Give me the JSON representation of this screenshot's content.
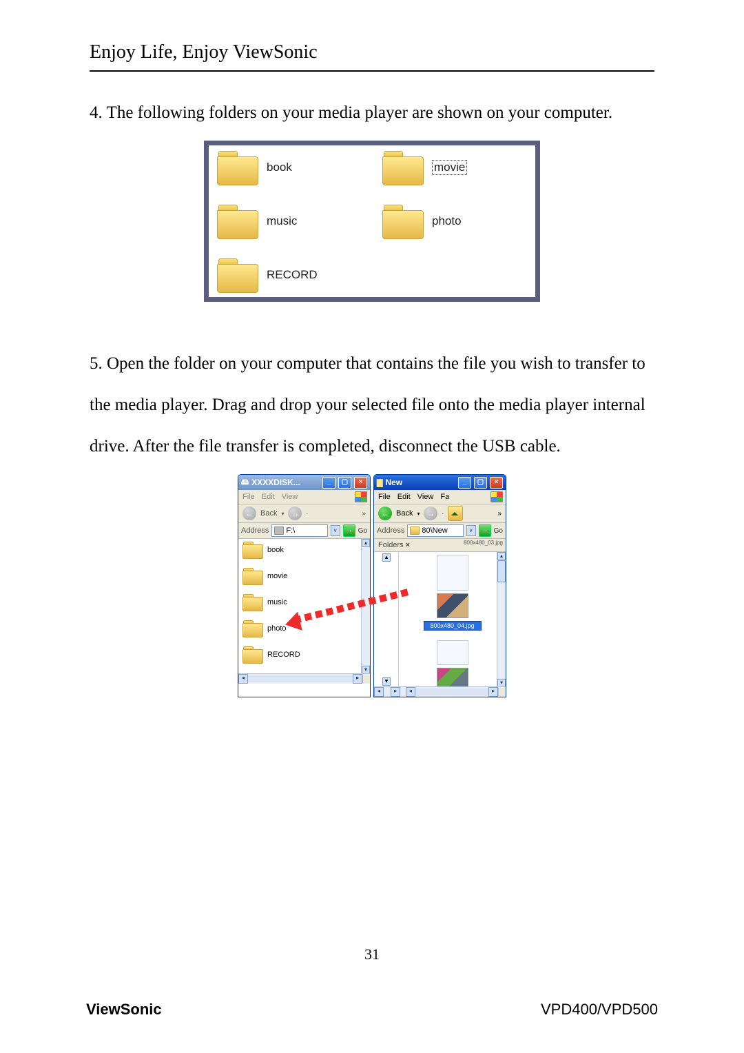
{
  "header": {
    "tagline": "Enjoy Life, Enjoy ViewSonic"
  },
  "step4": {
    "text": "4. The following folders on your media player are shown on your computer."
  },
  "folders_view": {
    "items": [
      {
        "label": "book"
      },
      {
        "label": "movie",
        "selected": true
      },
      {
        "label": "music"
      },
      {
        "label": "photo"
      },
      {
        "label": "RECORD"
      }
    ]
  },
  "step5": {
    "text": "5. Open the folder on your computer that contains the file you wish to transfer to the media player. Drag and drop your selected file onto the media player internal drive. After the file transfer is completed, disconnect the USB cable."
  },
  "explorer_left": {
    "title": "XXXXDISK...",
    "menu": {
      "file": "File",
      "edit": "Edit",
      "view": "View",
      "more": "»"
    },
    "toolbar": {
      "back": "Back",
      "more": "»"
    },
    "address": {
      "label": "Address",
      "value": "F:\\",
      "go": "Go"
    },
    "folders": [
      {
        "label": "book"
      },
      {
        "label": "movie"
      },
      {
        "label": "music"
      },
      {
        "label": "photo"
      },
      {
        "label": "RECORD"
      }
    ]
  },
  "explorer_right": {
    "title": "New",
    "menu": {
      "file": "File",
      "edit": "Edit",
      "view": "View",
      "fav": "Fa",
      "more": "»"
    },
    "toolbar": {
      "back": "Back",
      "more": "»"
    },
    "address": {
      "label": "Address",
      "value": "80\\New",
      "go": "Go"
    },
    "folders_panel": {
      "label": "Folders"
    },
    "overflow_filename": "800x480_03.jpg",
    "selected_file": "800x480_04.jpg"
  },
  "page_number": "31",
  "footer": {
    "brand": "ViewSonic",
    "model": "VPD400/VPD500"
  }
}
